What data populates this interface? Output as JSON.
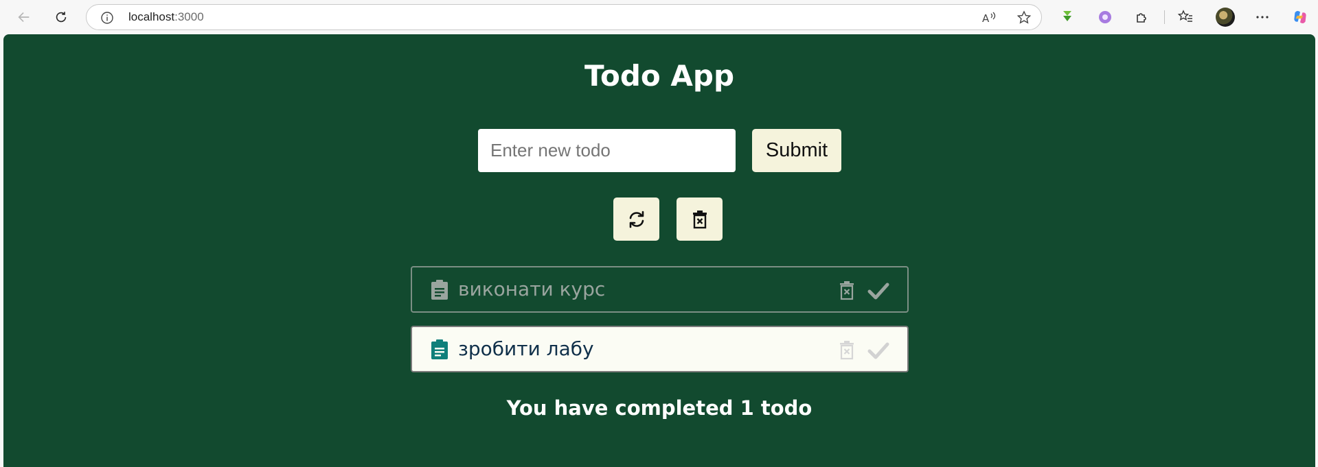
{
  "browser": {
    "url_host": "localhost",
    "url_port": ":3000",
    "icons": [
      "back-arrow-icon",
      "reload-icon",
      "site-info-icon",
      "read-aloud-icon",
      "favorite-star-icon",
      "download-extension-icon",
      "flower-extension-icon",
      "extensions-puzzle-icon",
      "favorites-list-icon",
      "profile-avatar",
      "more-dots-icon",
      "copilot-icon"
    ]
  },
  "app": {
    "title": "Todo App",
    "input_placeholder": "Enter new todo",
    "input_value": "",
    "submit_label": "Submit",
    "toolbar_icons": [
      "refresh-icon",
      "clear-all-icon"
    ]
  },
  "todos": [
    {
      "text": "виконати курс",
      "completed": true
    },
    {
      "text": "зробити лабу",
      "completed": false
    }
  ],
  "summary": "You have completed 1 todo",
  "colors": {
    "background": "#124a2f",
    "button": "#f5f3dc",
    "accent_teal": "#0f7f7a",
    "title_text": "#ffffff"
  }
}
